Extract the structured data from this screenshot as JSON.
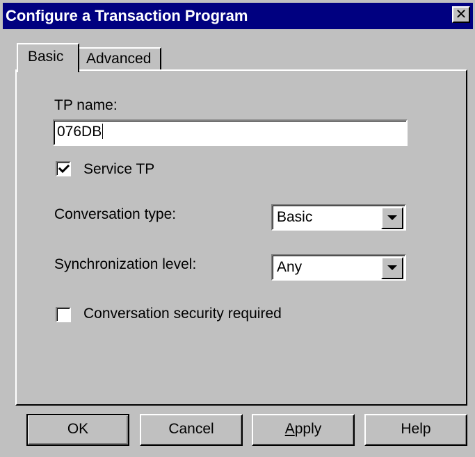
{
  "window": {
    "title": "Configure a Transaction Program",
    "close_glyph": "✕"
  },
  "tabs": [
    {
      "label": "Basic",
      "selected": true
    },
    {
      "label": "Advanced",
      "selected": false
    }
  ],
  "form": {
    "tp_name_label": "TP name:",
    "tp_name_value": "076DB",
    "service_tp_label": "Service TP",
    "service_tp_checked": true,
    "conversation_type_label": "Conversation type:",
    "conversation_type_value": "Basic",
    "sync_level_label": "Synchronization level:",
    "sync_level_value": "Any",
    "security_label": "Conversation security required",
    "security_checked": false
  },
  "buttons": {
    "ok": "OK",
    "cancel": "Cancel",
    "apply_mnemonic": "A",
    "apply_rest": "pply",
    "help": "Help"
  },
  "icons": {
    "close": "close-icon",
    "checkmark": "checkmark-icon",
    "dropdown": "chevron-down-icon"
  }
}
